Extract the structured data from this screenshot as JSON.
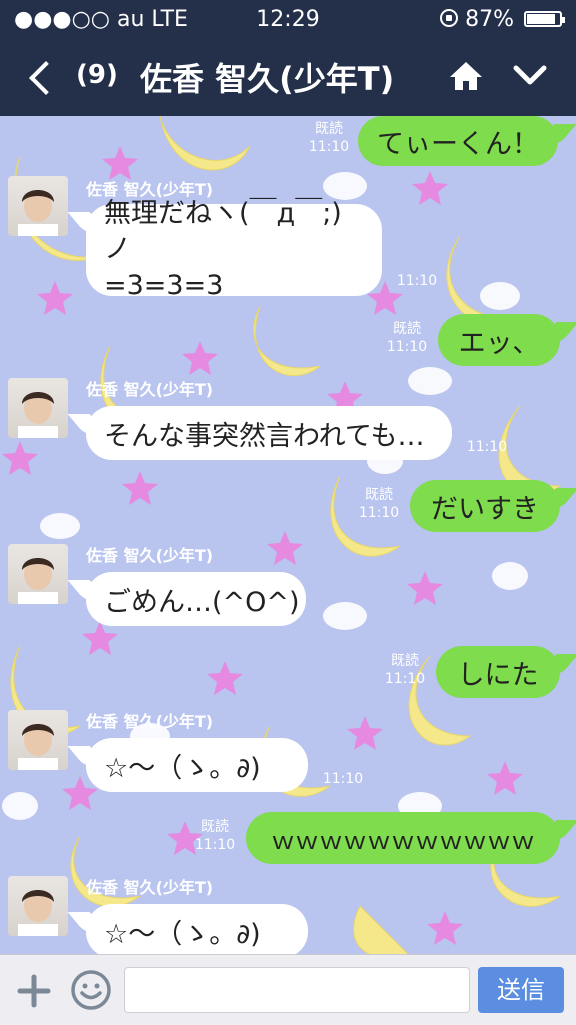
{
  "status_bar": {
    "carrier": "●●●○○ au   LTE",
    "time": "12:29",
    "battery_pct": "87%",
    "battery_level": 0.87
  },
  "header": {
    "unread_count": "(9)",
    "title": "佐香 智久(少年T)"
  },
  "colors": {
    "header_bg": "#24304a",
    "outgoing_bubble": "#7fdc4c",
    "incoming_bubble": "#ffffff",
    "wallpaper": "#b9c4ef",
    "send_button": "#5b8ee0"
  },
  "messages": [
    {
      "dir": "out",
      "text": "てぃーくん！",
      "read": "既読",
      "time": "11:10"
    },
    {
      "dir": "in",
      "sender": "佐香 智久(少年T)",
      "lines": [
        "無理だねヽ(￣д￣;)ノ",
        "=3=3=3"
      ],
      "time": "11:10"
    },
    {
      "dir": "out",
      "text": "エッ、",
      "read": "既読",
      "time": "11:10"
    },
    {
      "dir": "in",
      "sender": "佐香 智久(少年T)",
      "text": "そんな事突然言われても…",
      "time": "11:10"
    },
    {
      "dir": "out",
      "text": "だいすき",
      "read": "既読",
      "time": "11:10"
    },
    {
      "dir": "in",
      "sender": "佐香 智久(少年T)",
      "text": "ごめん…(^O^)",
      "time": ""
    },
    {
      "dir": "out",
      "text": "しにた",
      "read": "既読",
      "time": "11:10"
    },
    {
      "dir": "in",
      "sender": "佐香 智久(少年T)",
      "text": "☆〜（ゝ。∂)",
      "time": "11:10"
    },
    {
      "dir": "out",
      "text": "ｗｗｗｗｗｗｗｗｗｗｗ",
      "read": "既読",
      "time": "11:10"
    },
    {
      "dir": "in",
      "sender": "佐香 智久(少年T)",
      "text": "☆〜（ゝ。∂)",
      "time": ""
    }
  ],
  "input_bar": {
    "placeholder": "",
    "send_label": "送信"
  },
  "icons": {
    "back": "chevron-left-icon",
    "home": "home-icon",
    "menu": "chevron-down-icon",
    "plus": "plus-icon",
    "emoji": "smiley-icon",
    "lock": "rotation-lock-icon",
    "battery": "battery-icon"
  }
}
